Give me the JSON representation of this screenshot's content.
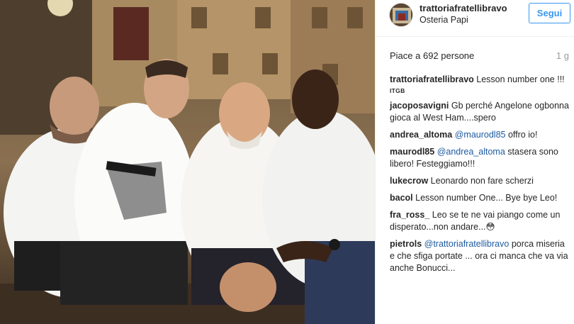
{
  "post": {
    "username": "trattoriafratellibravo",
    "location": "Osteria Papi",
    "follow_label": "Segui",
    "likes": "Piace a 692 persone",
    "time": "1 g"
  },
  "comments": [
    {
      "user": "trattoriafratellibravo",
      "text": "Lesson number one !!!",
      "sub": "ITGB"
    },
    {
      "user": "jacoposavigni",
      "text": "Gb perché Angelone ogbonna gioca al West Ham....spero"
    },
    {
      "user": "andrea_altoma",
      "mention": "@maurodl85",
      "text": "offro io!"
    },
    {
      "user": "maurodl85",
      "mention": "@andrea_altoma",
      "text": "stasera sono libero! Festeggiamo!!!"
    },
    {
      "user": "lukecrow",
      "text": "Leonardo non fare scherzi"
    },
    {
      "user": "bacol",
      "text": "Lesson number One... Bye bye Leo!"
    },
    {
      "user": "fra_ross_",
      "text": "Leo se te ne vai piango come un disperato...non andare...😳"
    },
    {
      "user": "pietrols",
      "mention": "@trattoriafratellibravo",
      "text": "porca miseria e che sfiga portate ... ora ci manca che va via anche Bonucci..."
    }
  ],
  "colors": {
    "link": "#3897f0",
    "mention": "#1e5aa0",
    "text": "#262626",
    "muted": "#999999"
  }
}
